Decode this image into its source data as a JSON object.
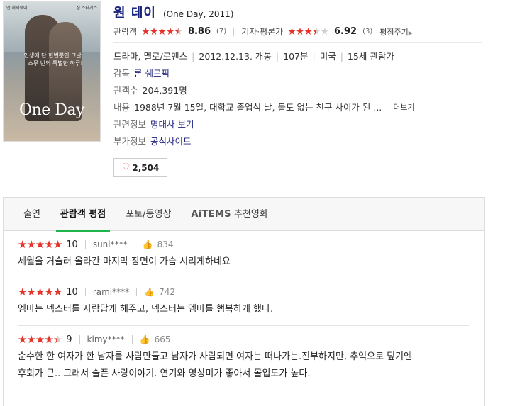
{
  "poster": {
    "tagline": "인생에 단 한번뿐인 그날... 스무 번의 특별한 하루!",
    "title": "One Day",
    "top_left": "앤 해서웨이",
    "top_right": "짐 스터게스"
  },
  "movie": {
    "title": "원 데이",
    "original_title": "(One Day, 2011)"
  },
  "ratings": {
    "audience_label": "관람객",
    "audience_score": "8.86",
    "audience_count": "(7)",
    "critic_label": "기자·평론가",
    "critic_score": "6.92",
    "critic_count": "(3)",
    "rate_link": "평점주기",
    "audience_stars": 4.5,
    "critic_stars": 3.5
  },
  "meta": {
    "genre": "드라마, 멜로/로맨스",
    "release": "2012.12.13. 개봉",
    "runtime": "107분",
    "country": "미국",
    "age": "15세 관람가",
    "director_label": "감독",
    "director": "론 쉐르픽",
    "audience_label": "관객수",
    "audience_count": "204,391명",
    "plot_label": "내용",
    "plot": "1988년 7월 15일, 대학교 졸업식 날, 둘도 없는 친구 사이가 된 ...",
    "plot_more": "더보기",
    "related_label": "관련정보",
    "related_link": "명대사 보기",
    "extra_label": "부가정보",
    "extra_link": "공식사이트"
  },
  "like": {
    "count": "2,504"
  },
  "tabs": [
    {
      "label": "출연"
    },
    {
      "label": "관람객 평점"
    },
    {
      "label": "포토/동영상"
    },
    {
      "label_brand": "AiTEMS",
      "label": "추천영화"
    }
  ],
  "reviews": [
    {
      "score": "10",
      "stars": 5,
      "user": "suni****",
      "likes": "834",
      "text": "세월을 거슬러 올라간 마지막 장면이 가슴 시리게하네요"
    },
    {
      "score": "10",
      "stars": 5,
      "user": "rami****",
      "likes": "742",
      "text": "엠마는 덱스터를 사람답게 해주고, 덱스터는 엠마를 행복하게 했다."
    },
    {
      "score": "9",
      "stars": 4.5,
      "user": "kimy****",
      "likes": "665",
      "text_line1": "순수한 한 여자가 한 남자를 사람만들고 남자가 사람되면 여자는 떠나가는.진부하지만, 추억으로 덮기엔",
      "text_line2": "후회가 큰.. 그래서 슬픈 사랑이야기. 연기와 영상미가 좋아서 몰입도가 높다."
    }
  ],
  "colors": {
    "star": "#e5332a",
    "title": "#1a237e",
    "tab_active": "#1fb54b"
  }
}
